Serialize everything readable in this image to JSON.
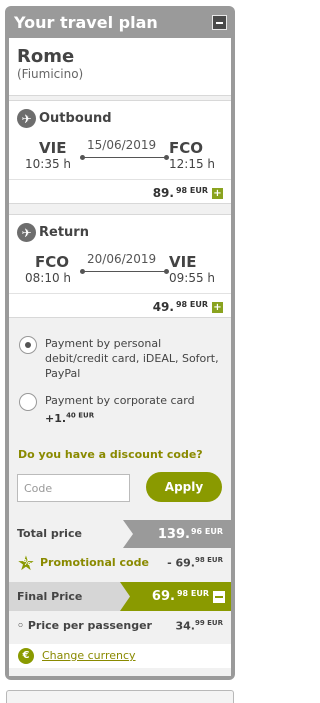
{
  "panel": {
    "title": "Your travel plan"
  },
  "destination": {
    "city": "Rome",
    "airport": "(Fiumicino)"
  },
  "outbound": {
    "label": "Outbound",
    "from_code": "VIE",
    "from_time": "10:35 h",
    "date": "15/06/2019",
    "to_code": "FCO",
    "to_time": "12:15 h",
    "price_main": "89.",
    "price_sup": "98 EUR"
  },
  "return": {
    "label": "Return",
    "from_code": "FCO",
    "from_time": "08:10 h",
    "date": "20/06/2019",
    "to_code": "VIE",
    "to_time": "09:55 h",
    "price_main": "49.",
    "price_sup": "98 EUR"
  },
  "payment": {
    "option1": "Payment by personal debit/credit card, iDEAL, Sofort, PayPal",
    "option2_text": "Payment by corporate card",
    "option2_fee_main": "+1.",
    "option2_fee_sup": "40 EUR"
  },
  "discount": {
    "title": "Do you have a discount code?",
    "placeholder": "Code",
    "apply_label": "Apply"
  },
  "totals": {
    "total_label": "Total price",
    "total_main": "139.",
    "total_sup": "96 EUR",
    "promo_label": "Promotional code",
    "promo_main": "- 69.",
    "promo_sup": "98 EUR",
    "final_label": "Final Price",
    "final_main": "69.",
    "final_sup": "98 EUR",
    "pp_label": "Price per passenger",
    "pp_main": "34.",
    "pp_sup": "99 EUR"
  },
  "currency": {
    "symbol": "€",
    "link_label": "Change currency"
  },
  "colors": {
    "accent": "#8a9a00",
    "panel_gray": "#9a9a9a"
  }
}
